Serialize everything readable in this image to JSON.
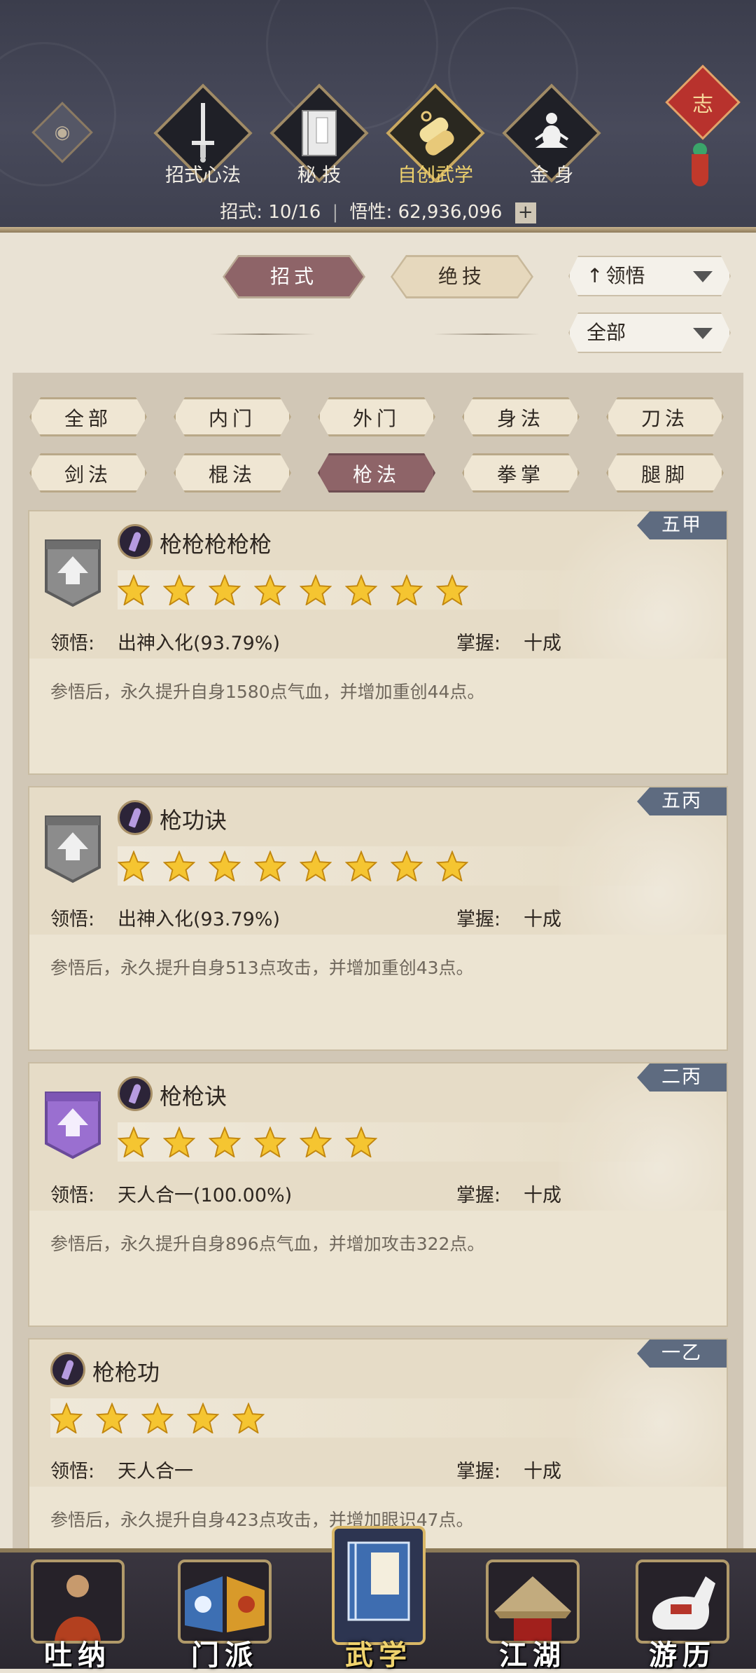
{
  "header": {
    "tabs": [
      {
        "label": "招式心法",
        "icon": "sword-icon",
        "active": false
      },
      {
        "label": "秘 技",
        "icon": "book-icon",
        "active": false
      },
      {
        "label": "自创武学",
        "icon": "scroll-icon",
        "active": true
      },
      {
        "label": "金 身",
        "icon": "meditation-icon",
        "active": false
      }
    ],
    "stat_label_moves": "招式:",
    "stat_value_moves": "10/16",
    "stat_label_insight": "悟性:",
    "stat_value_insight": "62,936,096",
    "plus": "+",
    "knot_char": "志",
    "eye_icon": "eye-icon"
  },
  "mode_tabs": [
    {
      "label": "招式",
      "active": true
    },
    {
      "label": "绝技",
      "active": false
    }
  ],
  "sort_dropdown": {
    "value": "领悟",
    "prefix_icon": "arrow-up-icon"
  },
  "filter_dropdown": {
    "value": "全部"
  },
  "categories": [
    {
      "label": "全部",
      "active": false
    },
    {
      "label": "内门",
      "active": false
    },
    {
      "label": "外门",
      "active": false
    },
    {
      "label": "身法",
      "active": false
    },
    {
      "label": "刀法",
      "active": false
    },
    {
      "label": "剑法",
      "active": false
    },
    {
      "label": "棍法",
      "active": false
    },
    {
      "label": "枪法",
      "active": true
    },
    {
      "label": "拳掌",
      "active": false
    },
    {
      "label": "腿脚",
      "active": false
    }
  ],
  "skills": [
    {
      "name": "枪枪枪枪枪",
      "tag": "五甲",
      "stars": 8,
      "badge": "grey",
      "insight_label": "领悟:",
      "insight": "出神入化(93.79%)",
      "mastery_label": "掌握:",
      "mastery": "十成",
      "desc": "参悟后，永久提升自身1580点气血，并增加重创44点。"
    },
    {
      "name": "枪功诀",
      "tag": "五丙",
      "stars": 8,
      "badge": "grey",
      "insight_label": "领悟:",
      "insight": "出神入化(93.79%)",
      "mastery_label": "掌握:",
      "mastery": "十成",
      "desc": "参悟后，永久提升自身513点攻击，并增加重创43点。"
    },
    {
      "name": "枪枪诀",
      "tag": "二丙",
      "stars": 6,
      "badge": "purple",
      "insight_label": "领悟:",
      "insight": "天人合一(100.00%)",
      "mastery_label": "掌握:",
      "mastery": "十成",
      "desc": "参悟后，永久提升自身896点气血，并增加攻击322点。"
    },
    {
      "name": "枪枪功",
      "tag": "一乙",
      "stars": 5,
      "badge": "none",
      "insight_label": "领悟:",
      "insight": "天人合一",
      "mastery_label": "掌握:",
      "mastery": "十成",
      "desc": "参悟后，永久提升自身423点攻击，并增加眼识47点。"
    }
  ],
  "bottom_nav": [
    {
      "label": "吐纳",
      "icon": "monk-icon",
      "active": false
    },
    {
      "label": "门派",
      "icon": "sect-icon",
      "active": false
    },
    {
      "label": "武学",
      "icon": "martial-book-icon",
      "active": true
    },
    {
      "label": "江湖",
      "icon": "straw-hat-icon",
      "active": false
    },
    {
      "label": "游历",
      "icon": "horse-icon",
      "active": false
    }
  ],
  "colors": {
    "header_bg": "#484a5b",
    "active_tab": "#8e6468",
    "active_nav_label": "#f0d36d",
    "tag_bg": "#5e6b80",
    "star": "#f5c531",
    "page_bg": "#e9e2d4"
  }
}
